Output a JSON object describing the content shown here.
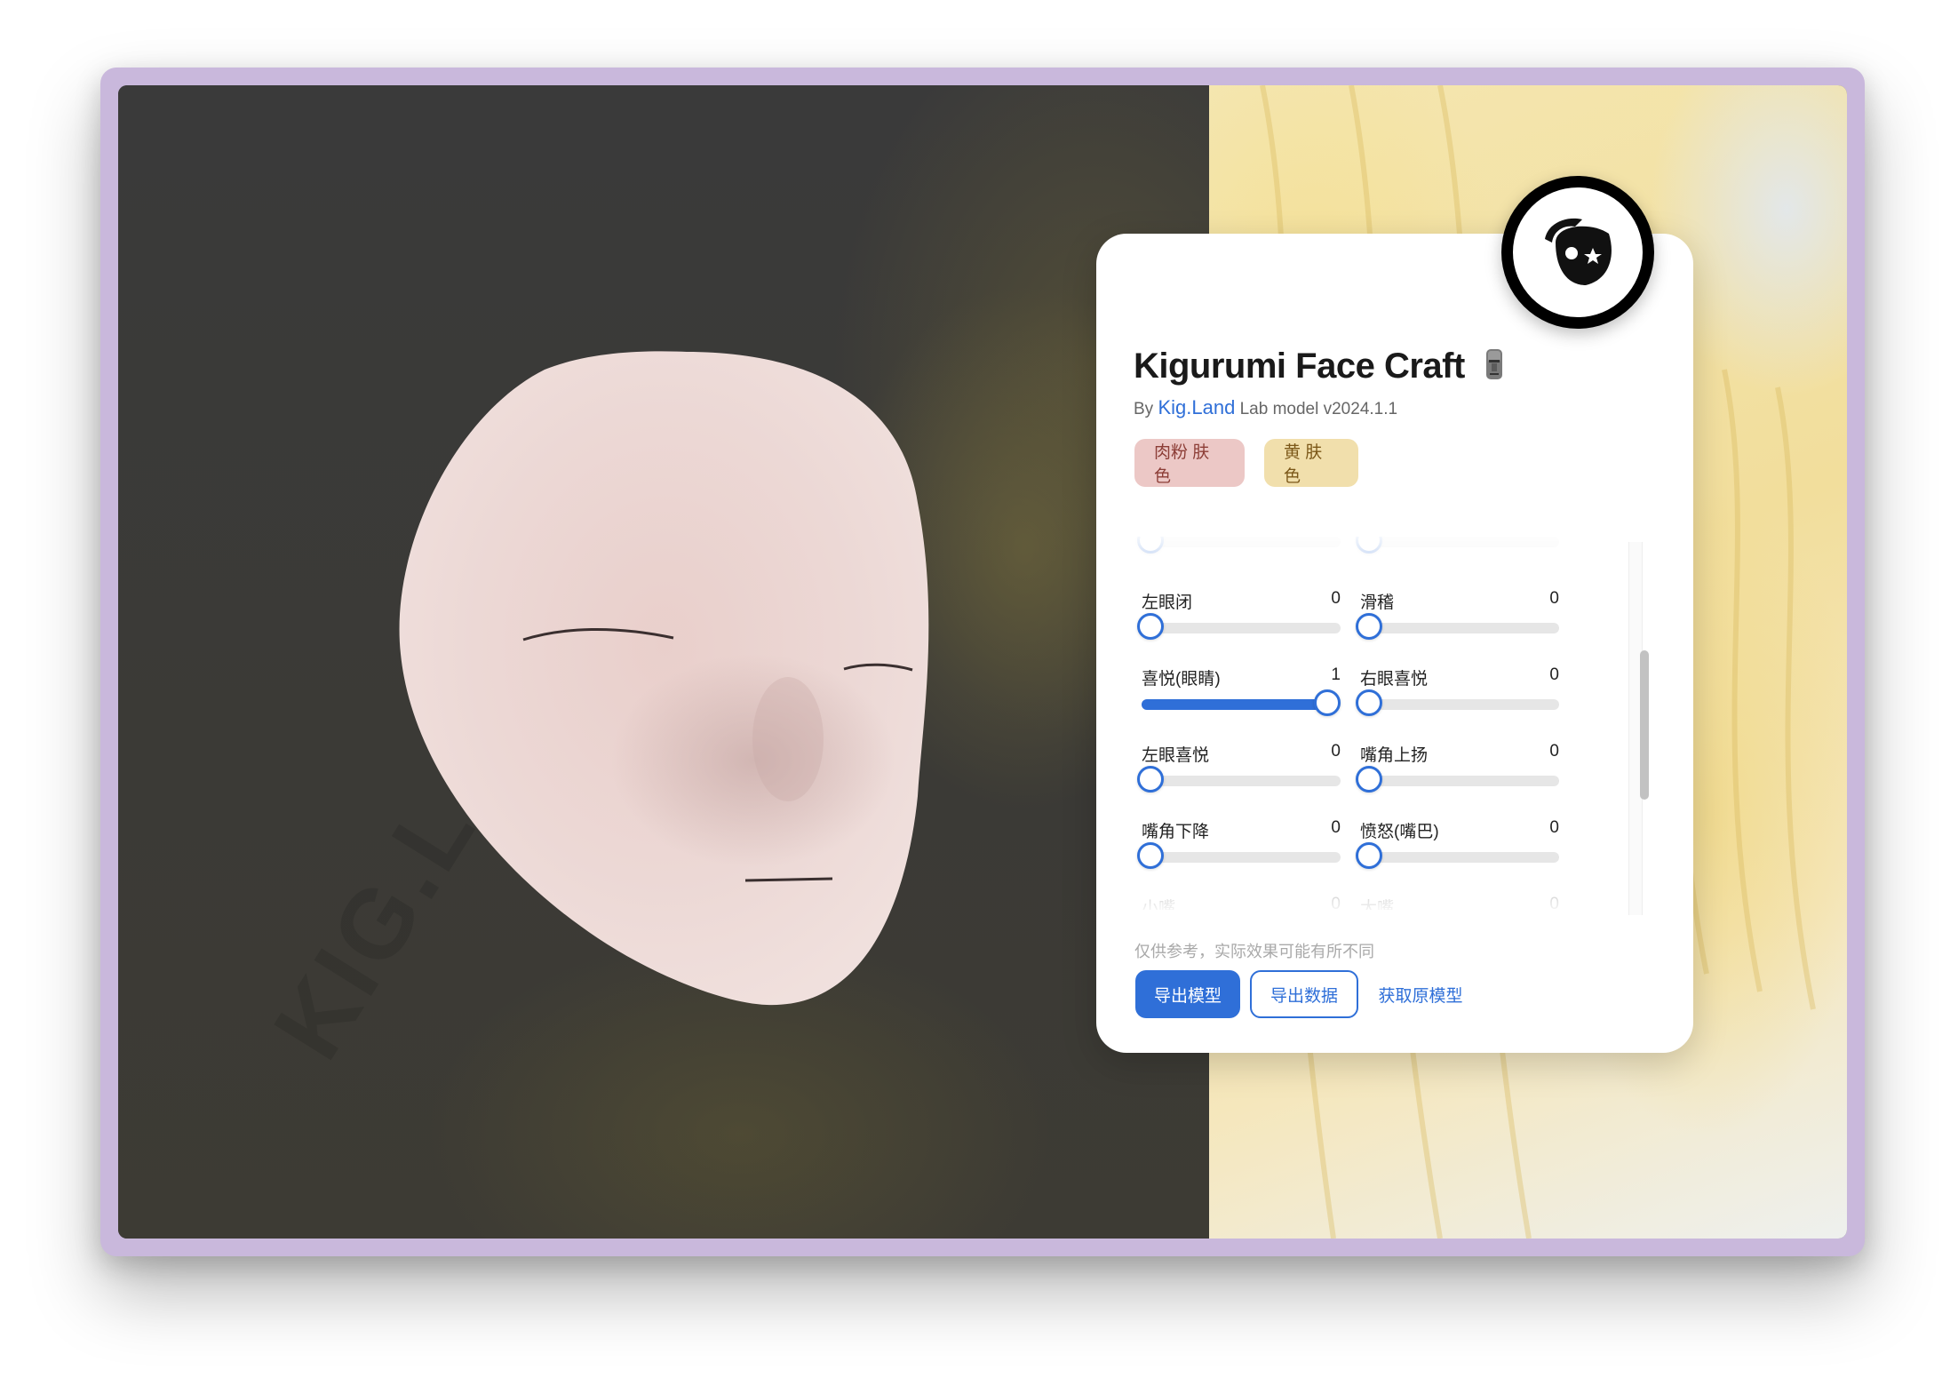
{
  "app": {
    "title": "Kigurumi Face Craft",
    "title_emoji_icon": "moai-icon",
    "subtitle_by": "By",
    "subtitle_link": "Kig.Land",
    "subtitle_rest": "Lab model v2024.1.1",
    "logo_icon": "kigurumi-mask-logo-icon",
    "watermark": "KIG.LAND"
  },
  "skin_tones": [
    {
      "label": "肉粉 肤色",
      "color": "#ecc8c6",
      "text_color": "#8c3d36"
    },
    {
      "label": "黄 肤色",
      "color": "#f1dfac",
      "text_color": "#7b5718"
    }
  ],
  "sliders": {
    "partial_top": [
      {
        "label": "",
        "value": 0
      },
      {
        "label": "",
        "value": 0
      }
    ],
    "rows": [
      [
        {
          "label": "左眼闭",
          "value": 0
        },
        {
          "label": "滑稽",
          "value": 0
        }
      ],
      [
        {
          "label": "喜悦(眼睛)",
          "value": 1
        },
        {
          "label": "右眼喜悦",
          "value": 0
        }
      ],
      [
        {
          "label": "左眼喜悦",
          "value": 0
        },
        {
          "label": "嘴角上扬",
          "value": 0
        }
      ],
      [
        {
          "label": "嘴角下降",
          "value": 0
        },
        {
          "label": "愤怒(嘴巴)",
          "value": 0
        }
      ],
      [
        {
          "label": "小嘴",
          "value": 0
        },
        {
          "label": "大嘴",
          "value": 0
        }
      ]
    ],
    "max": 1,
    "accent_color": "#2f6fd8"
  },
  "note": "仅供参考，实际效果可能有所不同",
  "buttons": {
    "export_model": "导出模型",
    "export_data": "导出数据",
    "get_original_model": "获取原模型"
  }
}
